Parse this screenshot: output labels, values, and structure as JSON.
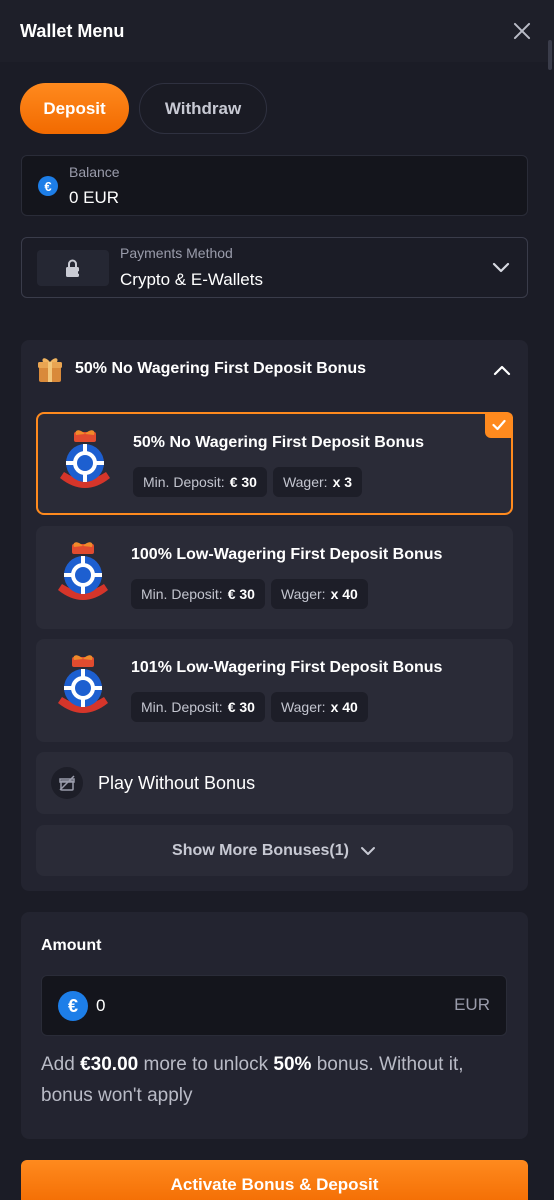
{
  "header": {
    "title": "Wallet Menu"
  },
  "tabs": {
    "deposit": "Deposit",
    "withdraw": "Withdraw"
  },
  "balance": {
    "label": "Balance",
    "value": "0 EUR",
    "currency_symbol": "€"
  },
  "payment": {
    "label": "Payments Method",
    "value": "Crypto & E-Wallets"
  },
  "bonus_section": {
    "title": "50% No Wagering First Deposit Bonus",
    "cards": [
      {
        "title": "50% No Wagering First Deposit Bonus",
        "min_label": "Min. Deposit:",
        "min_value": "€ 30",
        "wager_label": "Wager:",
        "wager_value": "x 3",
        "selected": true
      },
      {
        "title": "100% Low-Wagering First Deposit Bonus",
        "min_label": "Min. Deposit:",
        "min_value": "€ 30",
        "wager_label": "Wager:",
        "wager_value": "x 40",
        "selected": false
      },
      {
        "title": "101% Low-Wagering First Deposit Bonus",
        "min_label": "Min. Deposit:",
        "min_value": "€ 30",
        "wager_label": "Wager:",
        "wager_value": "x 40",
        "selected": false
      }
    ],
    "no_bonus_label": "Play Without Bonus",
    "show_more_label": "Show More Bonuses(1)"
  },
  "amount": {
    "label": "Amount",
    "value": "0",
    "currency": "EUR",
    "currency_symbol": "€",
    "info": {
      "part1": "Add ",
      "amount": "€30.00",
      "part2": " more to unlock ",
      "percent": "50%",
      "part3": " bonus. Without it, bonus won't apply"
    }
  },
  "cta_label": "Activate Bonus & Deposit",
  "colors": {
    "accent": "#ff8a1e",
    "background": "#1b1c26",
    "panel": "#232430",
    "card": "#2a2b37",
    "euro_blue": "#1d7ee8"
  }
}
